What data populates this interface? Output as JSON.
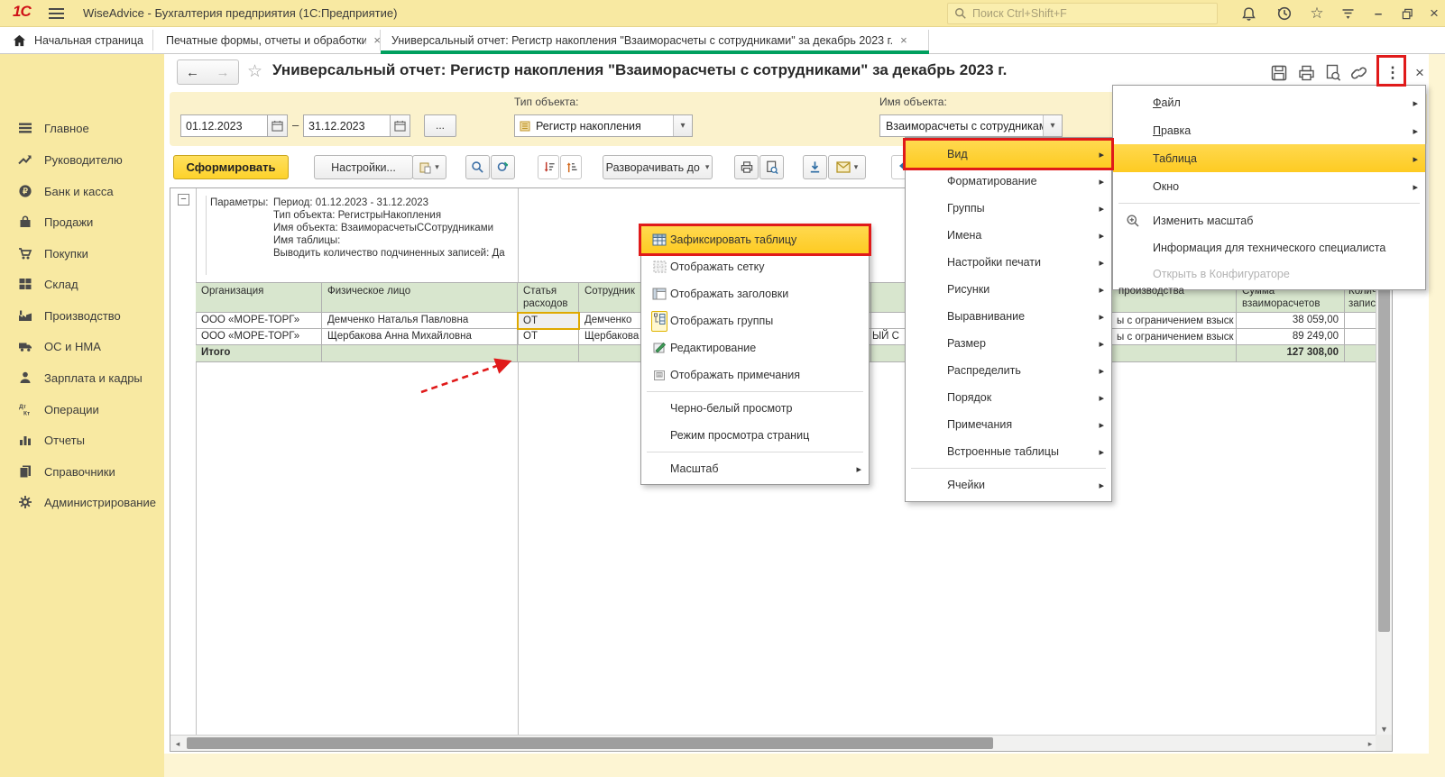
{
  "window": {
    "logo": "1С",
    "title": "WiseAdvice - Бухгалтерия предприятия  (1С:Предприятие)",
    "search_placeholder": "Поиск Ctrl+Shift+F"
  },
  "tabs": {
    "home_label": "Начальная страница",
    "tab1_label": "Печатные формы, отчеты и обработки",
    "tab2_label": "Универсальный отчет: Регистр накопления \"Взаиморасчеты с сотрудниками\" за декабрь 2023 г."
  },
  "sidebar": {
    "items": [
      {
        "label": "Главное"
      },
      {
        "label": "Руководителю"
      },
      {
        "label": "Банк и касса"
      },
      {
        "label": "Продажи"
      },
      {
        "label": "Покупки"
      },
      {
        "label": "Склад"
      },
      {
        "label": "Производство"
      },
      {
        "label": "ОС и НМА"
      },
      {
        "label": "Зарплата и кадры"
      },
      {
        "label": "Операции"
      },
      {
        "label": "Отчеты"
      },
      {
        "label": "Справочники"
      },
      {
        "label": "Администрирование"
      }
    ]
  },
  "report": {
    "title": "Универсальный отчет: Регистр накопления \"Взаиморасчеты с сотрудниками\" за декабрь 2023 г.",
    "date_from": "01.12.2023",
    "date_to": "31.12.2023",
    "dash": "–",
    "more_dates": "...",
    "type_label": "Тип объекта:",
    "type_value": "Регистр накопления",
    "name_label": "Имя объекта:",
    "name_value": "Взаиморасчеты с сотрудниками",
    "btn_generate": "Сформировать",
    "btn_settings": "Настройки...",
    "btn_expand": "Разворачивать до",
    "params_label": "Параметры:",
    "params": [
      "Период: 01.12.2023 - 31.12.2023",
      "Тип объекта: РегистрыНакопления",
      "Имя объекта: ВзаиморасчетыССотрудниками",
      "Имя таблицы:",
      "Выводить количество подчиненных записей: Да"
    ]
  },
  "sheet": {
    "headers": {
      "org": "Организация",
      "person": "Физическое лицо",
      "article": "Статья расходов",
      "employee": "Сотрудник",
      "production_fragment": "производства",
      "sum": "Сумма взаиморасчетов",
      "count_line1": "Количество",
      "count_line2": "записей"
    },
    "rows": [
      {
        "org": "ООО «МОРЕ-ТОРГ»",
        "person": "Демченко Наталья Павловна",
        "article": "ОТ",
        "employee": "Демченко",
        "production": "ы с ограничением взыскания",
        "sum": "38 059,00"
      },
      {
        "org": "ООО «МОРЕ-ТОРГ»",
        "person": "Щербакова Анна Михайловна",
        "article": "ОТ",
        "employee": "Щербакова",
        "hidden_fragment": "ЫЙ С",
        "production": "ы с ограничением взыскания",
        "sum": "89 249,00"
      }
    ],
    "total_label": "Итого",
    "total_value": "127 308,00"
  },
  "context_menu": {
    "items": [
      {
        "label": "Зафиксировать таблицу"
      },
      {
        "label": "Отображать сетку"
      },
      {
        "label": "Отображать заголовки"
      },
      {
        "label": "Отображать группы"
      },
      {
        "label": "Редактирование"
      },
      {
        "label": "Отображать примечания"
      },
      {
        "label": "Черно-белый просмотр"
      },
      {
        "label": "Режим просмотра страниц"
      },
      {
        "label": "Масштаб"
      }
    ]
  },
  "table_menu": {
    "items": [
      {
        "label": "Вид"
      },
      {
        "label": "Форматирование"
      },
      {
        "label": "Группы"
      },
      {
        "label": "Имена"
      },
      {
        "label": "Настройки печати"
      },
      {
        "label": "Рисунки"
      },
      {
        "label": "Выравнивание"
      },
      {
        "label": "Размер"
      },
      {
        "label": "Распределить"
      },
      {
        "label": "Порядок"
      },
      {
        "label": "Примечания"
      },
      {
        "label": "Встроенные таблицы"
      },
      {
        "label": "Ячейки"
      }
    ]
  },
  "main_menu": {
    "items": [
      {
        "label": "Файл"
      },
      {
        "label": "Правка"
      },
      {
        "label": "Таблица"
      },
      {
        "label": "Окно"
      },
      {
        "label": "Изменить масштаб"
      },
      {
        "label": "Информация для технического специалиста"
      },
      {
        "label": "Открыть в Конфигураторе"
      }
    ]
  },
  "colors": {
    "accent_gold": "#fecb22",
    "annotation_red": "#e01a1a",
    "tab_green": "#00a05f",
    "header_green": "#d8e6ce"
  }
}
